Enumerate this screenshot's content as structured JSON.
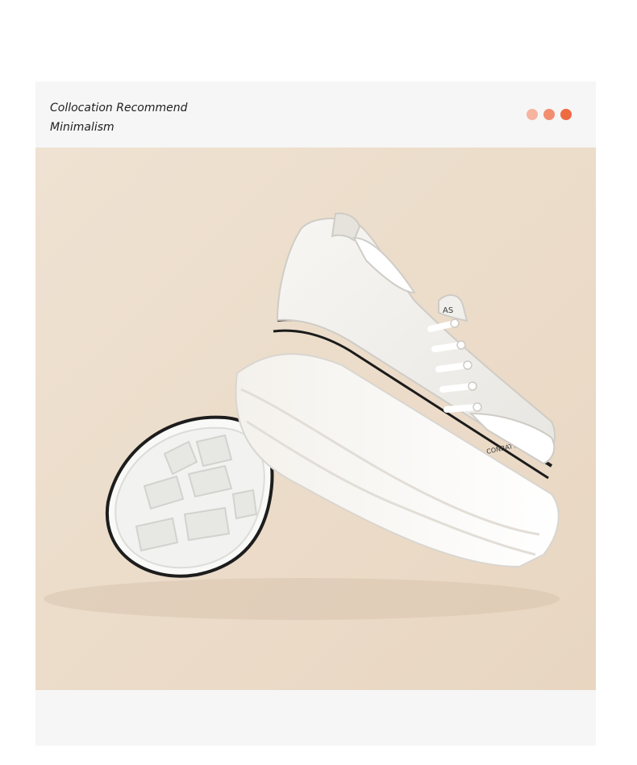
{
  "header": {
    "line1": "Collocation Recommend",
    "line2": "Minimalism"
  },
  "dots": [
    {
      "name": "dot-1",
      "color": "#f6b3a0"
    },
    {
      "name": "dot-2",
      "color": "#f28e6f"
    },
    {
      "name": "dot-3",
      "color": "#ee6a43"
    }
  ],
  "photo": {
    "description_icon": "platform-sneaker-image",
    "background_color": "#eddecc",
    "shoe_tongue_text": "AS",
    "shoe_side_text": "CONBATTO"
  }
}
